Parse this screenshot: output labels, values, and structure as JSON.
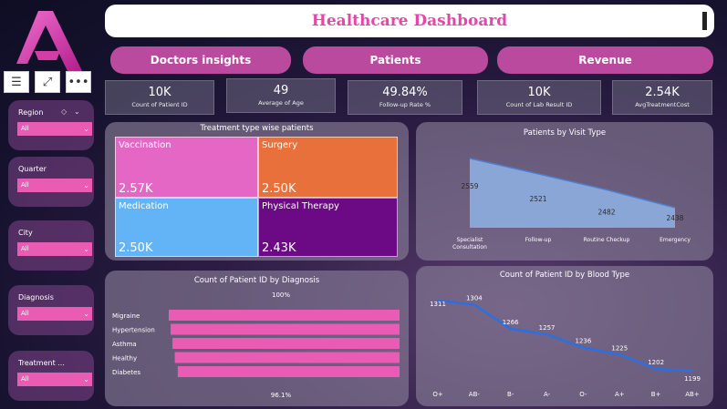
{
  "logo": {
    "brand_color": "#e546a8",
    "partial_text": "A"
  },
  "toolbar": [
    {
      "name": "filter-icon",
      "glyph": "☰"
    },
    {
      "name": "focus-mode-icon",
      "glyph": "⤢"
    },
    {
      "name": "more-options-icon",
      "glyph": "•••"
    }
  ],
  "slicers": [
    {
      "label": "Region",
      "value": "All"
    },
    {
      "label": "Quarter",
      "value": "All"
    },
    {
      "label": "City",
      "value": "All"
    },
    {
      "label": "Diagnosis",
      "value": "All"
    },
    {
      "label": "Treatment ...",
      "value": "All"
    }
  ],
  "header": {
    "title": "Healthcare Dashboard"
  },
  "nav": [
    "Doctors insights",
    "Patients",
    "Revenue"
  ],
  "kpis": [
    {
      "value": "10K",
      "label": "Count of Patient ID"
    },
    {
      "value": "49",
      "label": "Average of Age"
    },
    {
      "value": "49.84%",
      "label": "Follow-up Rate %"
    },
    {
      "value": "10K",
      "label": "Count of Lab Result ID"
    },
    {
      "value": "2.54K",
      "label": "AvgTreatmentCost"
    }
  ],
  "treemap": {
    "title": "Treatment type wise patients",
    "tiles": [
      {
        "name": "Vaccination",
        "value": "2.57K",
        "color": "#e567c5"
      },
      {
        "name": "Surgery",
        "value": "2.50K",
        "color": "#e8703b"
      },
      {
        "name": "Medication",
        "value": "2.50K",
        "color": "#63b4f7"
      },
      {
        "name": "Physical Therapy",
        "value": "2.43K",
        "color": "#6c0a86"
      }
    ]
  },
  "chart_data": [
    {
      "type": "area",
      "title": "Patients by Visit Type",
      "categories": [
        "Specialist Consultation",
        "Follow-up",
        "Routine Checkup",
        "Emergency"
      ],
      "values": [
        2559,
        2521,
        2482,
        2438
      ],
      "labels": [
        "2559",
        "2521",
        "2482",
        "2438"
      ],
      "color": "#8fb3e6"
    },
    {
      "type": "bar",
      "orientation": "horizontal",
      "title": "Count of Patient ID by Diagnosis",
      "categories": [
        "Migraine",
        "Hypertension",
        "Asthma",
        "Healthy",
        "Diabetes"
      ],
      "values": [
        100,
        99.2,
        98.4,
        97.4,
        96.1
      ],
      "top_label": "100%",
      "bottom_label": "96.1%",
      "color": "#ea5bb4"
    },
    {
      "type": "line",
      "title": "Count of Patient ID by Blood Type",
      "categories": [
        "O+",
        "AB-",
        "B-",
        "A-",
        "O-",
        "A+",
        "B+",
        "AB+"
      ],
      "values": [
        1311,
        1304,
        1266,
        1257,
        1236,
        1225,
        1202,
        1199
      ],
      "labels": [
        "1311",
        "1304",
        "1266",
        "1257",
        "1236",
        "1225",
        "1202",
        "1199"
      ],
      "color": "#2c6fe0"
    }
  ]
}
